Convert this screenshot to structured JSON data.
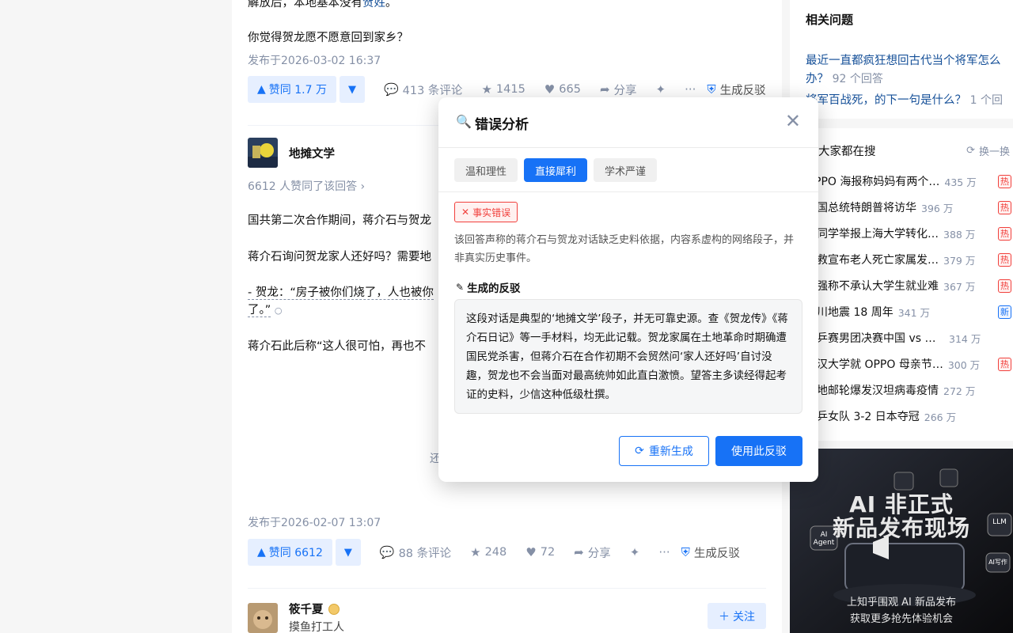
{
  "answer1": {
    "line_top_prefix": "解放后，本地基本没有",
    "line_top_link": "贺姓",
    "line_top_suffix": "。",
    "question_line": "你觉得贺龙愿不愿意回到家乡？",
    "published": "发布于2026-03-02 16:37",
    "vote_up": "赞同 1.7 万",
    "comments": "413 条评论",
    "stars": "1415",
    "likes": "665",
    "share": "分享",
    "rebut": "生成反驳"
  },
  "answer2": {
    "author": "地摊文学",
    "vote_count_text": "6612 人赞同了该回答",
    "line1": "国共第二次合作期间，蒋介石与贺龙",
    "line2": "蒋介石询问贺龙家人还好吗？需要地",
    "line3": "- 贺龙：“房子被你们烧了，人也被你",
    "line4": "了。”",
    "line5": "蒋介石此后称“这人很可怕，再也不",
    "expand_fragment": "还",
    "published": "发布于2026-02-07 13:07",
    "vote_up": "赞同 6612",
    "comments": "88 条评论",
    "stars": "248",
    "likes": "72",
    "share": "分享",
    "rebut": "生成反驳"
  },
  "answer3": {
    "author": "筱千夏",
    "bio": "摸鱼打工人",
    "follow": "关注"
  },
  "sidebar": {
    "related_title": "相关问题",
    "related": [
      {
        "text": "最近一直都疯狂想回古代当个将军怎么办？",
        "count": "92 个回答"
      },
      {
        "text": "将军百战死，的下一句是什么？",
        "count": "1 个回答"
      }
    ],
    "hot_title": "大家都在搜",
    "refresh": "换一换",
    "hot": [
      {
        "title": "OPPO 海报称妈妈有两个…",
        "heat": "435 万",
        "badge": "热"
      },
      {
        "title": "美国总统特朗普将访华",
        "heat": "396 万",
        "badge": "热"
      },
      {
        "title": "女同学举报上海大学转化…",
        "heat": "388 万",
        "badge": "热"
      },
      {
        "title": "急救宣布老人死亡家属发…",
        "heat": "379 万",
        "badge": "热"
      },
      {
        "title": "郎强称不承认大学生就业难",
        "heat": "367 万",
        "badge": "热"
      },
      {
        "title": "汶川地震 18 周年",
        "heat": "341 万",
        "badge": "新"
      },
      {
        "title": "世乒赛男团决赛中国 vs 日本",
        "heat": "314 万",
        "badge": ""
      },
      {
        "title": "武汉大学就 OPPO 母亲节…",
        "heat": "300 万",
        "badge": "热"
      },
      {
        "title": "极地邮轮爆发汉坦病毒疫情",
        "heat": "272 万",
        "badge": ""
      },
      {
        "title": "国乒女队 3-2 日本夺冠",
        "heat": "266 万",
        "badge": ""
      }
    ],
    "ad": {
      "title_line1": "AI 非正式",
      "title_line2": "新品发布现场",
      "tag_ai_agent": "AI Agent",
      "tag_llm": "LLM",
      "tag_ai_write": "AI写作",
      "bottom_line1": "上知乎围观 AI 新品发布",
      "bottom_line2": "获取更多抢先体验机会"
    }
  },
  "modal": {
    "title": "错误分析",
    "tabs": [
      "温和理性",
      "直接犀利",
      "学术严谨"
    ],
    "active_tab": 1,
    "error_tag": "事实错误",
    "description": "该回答声称的蒋介石与贺龙对话缺乏史料依据，内容系虚构的网络段子，并非真实历史事件。",
    "rebuttal_heading": "生成的反驳",
    "rebuttal_text": "这段对话是典型的‘地摊文学’段子，并无可靠史源。查《贺龙传》《蒋介石日记》等一手材料，均无此记载。贺龙家属在土地革命时期确遭国民党杀害，但蒋介石在合作初期不会贸然问‘家人还好吗’自讨没趣，贺龙也不会当面对最高统帅如此直白激愤。望答主多读经得起考证的史料，少信这种低级杜撰。",
    "regenerate": "重新生成",
    "use": "使用此反驳"
  },
  "colors": {
    "brand_blue": "#1772f6",
    "link_blue": "#175199",
    "muted": "#8590a6",
    "hot_red": "#f1403c"
  }
}
